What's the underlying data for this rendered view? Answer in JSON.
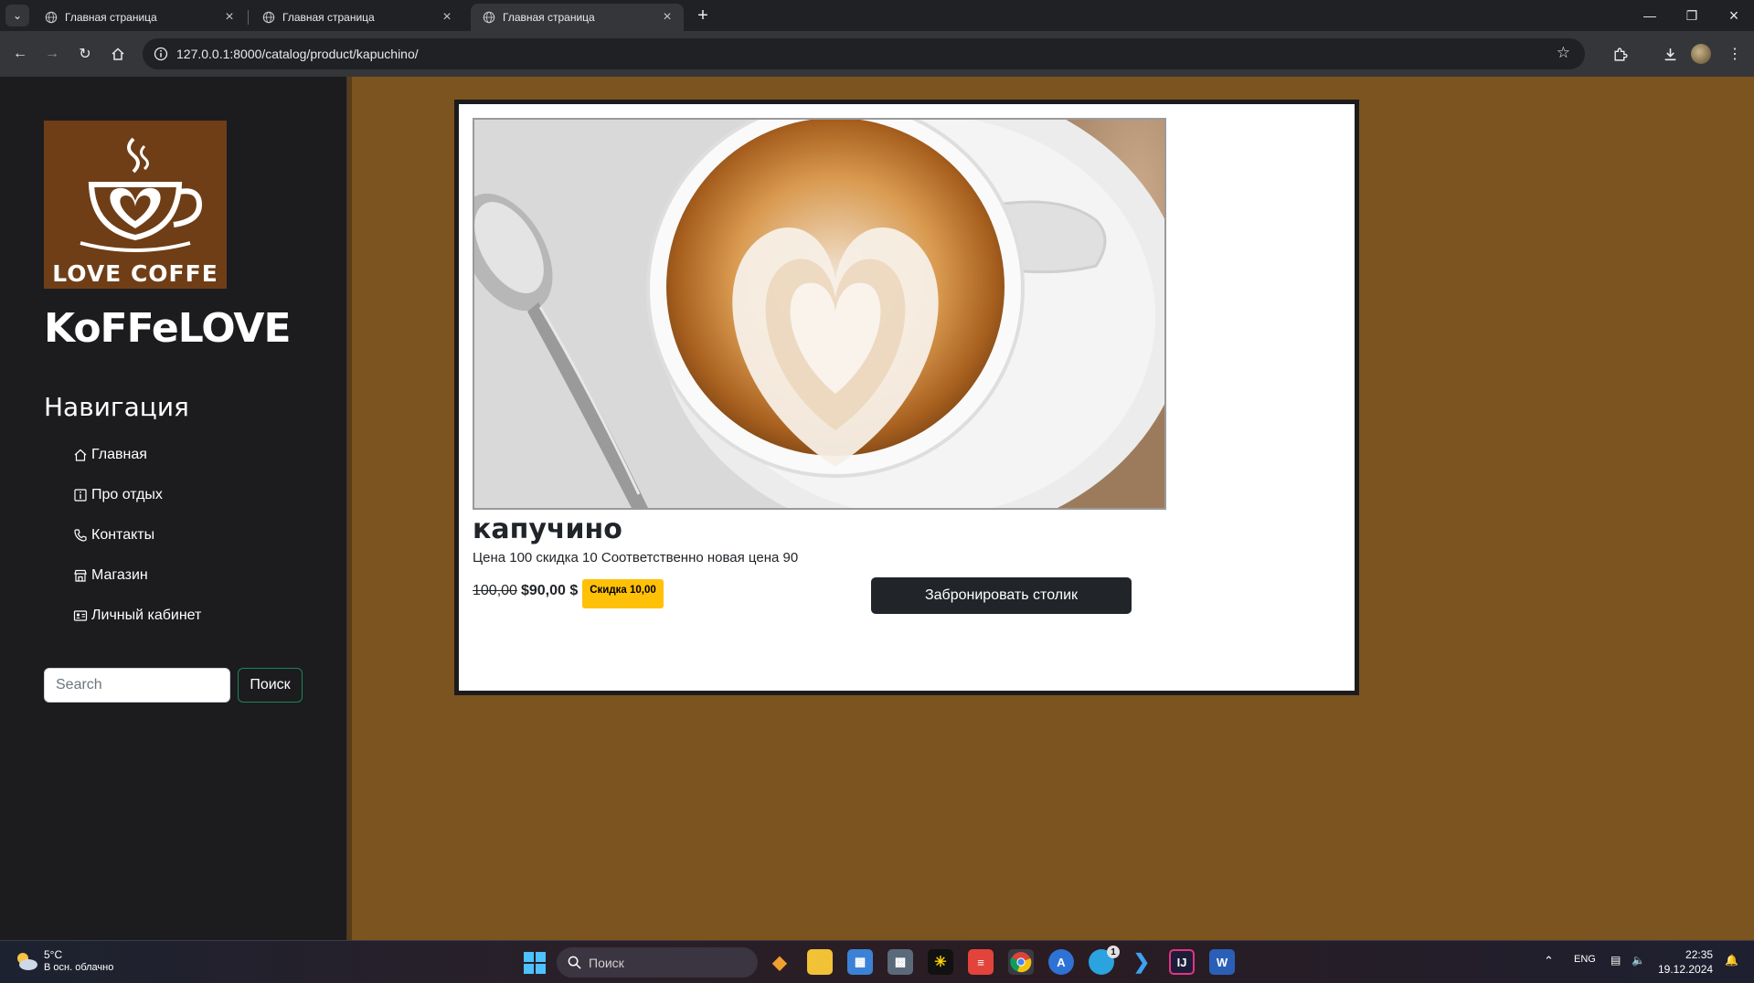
{
  "browser": {
    "tabs": [
      {
        "title": "Главная страница",
        "active": false
      },
      {
        "title": "Главная страница",
        "active": false
      },
      {
        "title": "Главная страница",
        "active": true
      }
    ],
    "url": "127.0.0.1:8000/catalog/product/kapuchino/"
  },
  "sidebar": {
    "logo_text": "LOVE COFFE",
    "brand": "KoFFeLOVE",
    "nav_heading": "Навигация",
    "nav_items": [
      {
        "label": "Главная",
        "icon": "home-icon"
      },
      {
        "label": "Про отдых",
        "icon": "info-icon"
      },
      {
        "label": "Контакты",
        "icon": "phone-icon"
      },
      {
        "label": "Магазин",
        "icon": "shop-icon"
      },
      {
        "label": "Личный кабинет",
        "icon": "person-card-icon"
      }
    ],
    "search": {
      "placeholder": "Search",
      "button": "Поиск"
    }
  },
  "product": {
    "title": "капучино",
    "description": "Цена 100 скидка 10 Соответственно новая цена 90",
    "old_price": "100,00",
    "new_price": "$90,00 $",
    "discount_badge": "Скидка 10,00",
    "book_button": "Забронировать столик"
  },
  "taskbar": {
    "weather_temp": "5°C",
    "weather_desc": "В осн. облачно",
    "search_label": "Поиск",
    "lang": "ENG",
    "time": "22:35",
    "date": "19.12.2024",
    "telegram_badge": "1"
  },
  "colors": {
    "page_bg": "#7b5420",
    "sidebar_bg": "#1c1c1f",
    "badge": "#ffc107",
    "button_dark": "#212529"
  }
}
